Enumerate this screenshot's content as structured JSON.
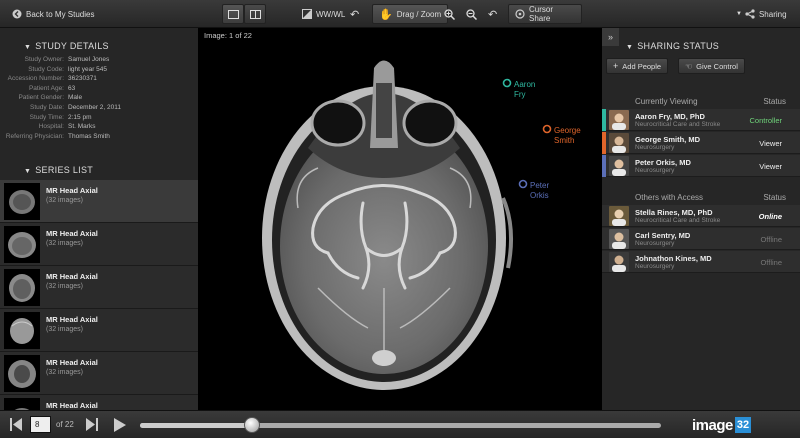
{
  "toolbar": {
    "back_label": "Back to My Studies",
    "wwwl_label": "WW/WL",
    "drag_zoom_label": "Drag / Zoom",
    "cursor_share_label": "Cursor Share",
    "sharing_label": "Sharing"
  },
  "study_details": {
    "title": "STUDY DETAILS",
    "rows": [
      {
        "label": "Study Owner:",
        "value": "Samuel Jones"
      },
      {
        "label": "Study Code:",
        "value": "light year 545"
      },
      {
        "label": "Accession Number:",
        "value": "36230371"
      },
      {
        "label": "Patient Age:",
        "value": "63"
      },
      {
        "label": "Patient Gender:",
        "value": "Male"
      },
      {
        "label": "Study Date:",
        "value": "December 2, 2011"
      },
      {
        "label": "Study Time:",
        "value": "2:15 pm"
      },
      {
        "label": "Hospital:",
        "value": "St. Marks"
      },
      {
        "label": "Referring Physician:",
        "value": "Thomas Smith"
      }
    ]
  },
  "series_list": {
    "title": "SERIES LIST",
    "items": [
      {
        "name": "MR Head Axial",
        "count": "(32 images)"
      },
      {
        "name": "MR Head Axial",
        "count": "(32 images)"
      },
      {
        "name": "MR Head Axial",
        "count": "(32 images)"
      },
      {
        "name": "MR Head Axial",
        "count": "(32 images)"
      },
      {
        "name": "MR Head Axial",
        "count": "(32 images)"
      },
      {
        "name": "MR Head Axial",
        "count": ""
      }
    ]
  },
  "viewer": {
    "image_counter": "Image: 1 of 22",
    "cursors": [
      {
        "name_line1": "Aaron",
        "name_line2": "Fry",
        "color": "#2fb8a0"
      },
      {
        "name_line1": "George",
        "name_line2": "Smith",
        "color": "#e0652b"
      },
      {
        "name_line1": "Peter",
        "name_line2": "Orkis",
        "color": "#5b6fb8"
      }
    ]
  },
  "sharing": {
    "title": "SHARING STATUS",
    "add_people_label": "Add People",
    "give_control_label": "Give Control",
    "currently_viewing_label": "Currently Viewing",
    "status_label": "Status",
    "others_label": "Others with Access",
    "viewing": [
      {
        "name": "Aaron Fry, MD, PhD",
        "dept": "Neurocritical Care and Stroke",
        "status": "Controller",
        "bar": "#2fb8a0",
        "status_color": "#6fd37a"
      },
      {
        "name": "George Smith, MD",
        "dept": "Neurosurgery",
        "status": "Viewer",
        "bar": "#e0652b",
        "status_color": "#eeeeee"
      },
      {
        "name": "Peter Orkis, MD",
        "dept": "Neurosurgery",
        "status": "Viewer",
        "bar": "#5b6fb8",
        "status_color": "#eeeeee"
      }
    ],
    "others": [
      {
        "name": "Stella Rines, MD, PhD",
        "dept": "Neurocritical Care and Stroke",
        "status": "Online",
        "status_color": "#ffffff"
      },
      {
        "name": "Carl Sentry, MD",
        "dept": "Neurosurgery",
        "status": "Offline",
        "status_color": "#777777"
      },
      {
        "name": "Johnathon Kines, MD",
        "dept": "Neurosurgery",
        "status": "Offline",
        "status_color": "#777777"
      }
    ]
  },
  "playback": {
    "current_frame": "8",
    "total_label": "of 22",
    "progress": 0.215
  },
  "brand": {
    "text": "image",
    "number": "32"
  },
  "icons": {
    "back": "back-arrow-icon",
    "layout_single": "single-layout-icon",
    "layout_split": "split-layout-icon",
    "contrast": "contrast-icon",
    "undo": "undo-icon",
    "hand": "hand-icon",
    "zoom_in": "zoom-in-icon",
    "zoom_out": "zoom-out-icon",
    "reset": "reset-icon",
    "cursor": "cursor-icon",
    "share": "share-icon"
  }
}
